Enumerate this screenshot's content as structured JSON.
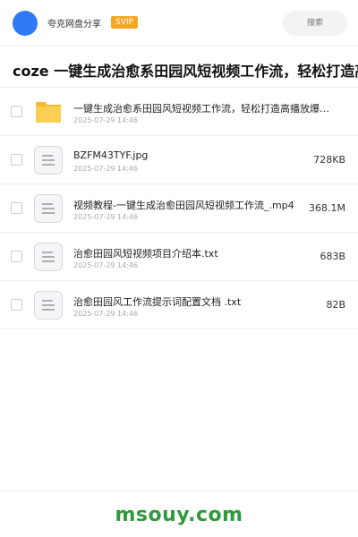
{
  "header": {
    "app_name": "夸克网盘分享",
    "badge": "SVIP",
    "search_placeholder": "搜索"
  },
  "title": "coze 一键生成治愈系田园风短视频工作流，轻松打造高播放",
  "files": [
    {
      "type": "folder",
      "icon": "folder-icon",
      "name": "一键生成治愈系田园风短视频工作流，轻松打造高播放爆…",
      "date": "2025-07-29 14:46",
      "size": ""
    },
    {
      "type": "file",
      "icon": "file-icon",
      "name": "BZFM43TYF.jpg",
      "date": "2025-07-29 14:46",
      "size": "728KB"
    },
    {
      "type": "file",
      "icon": "file-icon",
      "name": "视频教程-一键生成治愈田园风短视频工作流_.mp4",
      "date": "2025-07-29 14:46",
      "size": "368.1M"
    },
    {
      "type": "file",
      "icon": "file-icon",
      "name": "治愈田园风短视频项目介绍本.txt",
      "date": "2025-07-29 14:46",
      "size": "683B"
    },
    {
      "type": "file",
      "icon": "file-icon",
      "name": "治愈田园风工作流提示词配置文档 .txt",
      "date": "2025-07-29 14:46",
      "size": "82B"
    }
  ],
  "footer": {
    "watermark": "msouy.com"
  },
  "colors": {
    "accent": "#2f7bf5",
    "svip": "#f5a623",
    "folder": "#f7c843",
    "watermark": "#2e9a3c"
  }
}
